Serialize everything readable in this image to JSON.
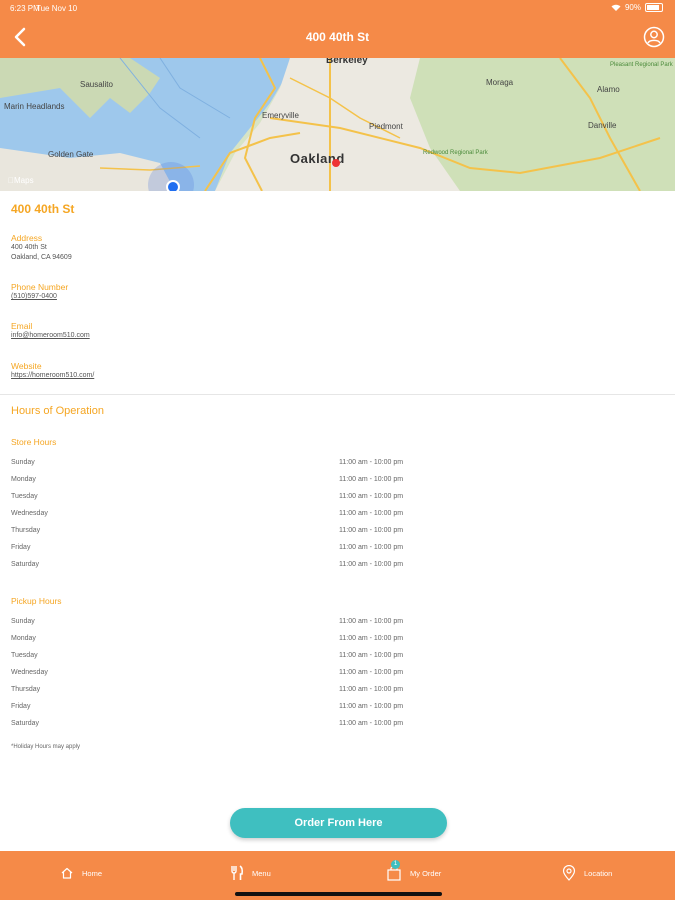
{
  "status_bar": {
    "time": "6:23 PM",
    "date": "Tue Nov 10",
    "battery": "90%"
  },
  "header": {
    "title": "400 40th St"
  },
  "map": {
    "labels": [
      "Berkeley",
      "Oakland",
      "Emeryville",
      "Piedmont",
      "Moraga",
      "Alamo",
      "Danville",
      "Sausalito",
      "Marin Headlands",
      "Golden Gate",
      "Redwood Regional Park",
      "Pleasant Regional Park"
    ],
    "attribution": "Maps"
  },
  "store": {
    "name": "400 40th St",
    "address_label": "Address",
    "address_line1": "400 40th St",
    "address_line2": "Oakland, CA 94609",
    "phone_label": "Phone Number",
    "phone": "(510)597-0400",
    "email_label": "Email",
    "email": "info@homeroom510.com",
    "website_label": "Website",
    "website": "https://homeroom510.com/"
  },
  "hours": {
    "title": "Hours of Operation",
    "store_title": "Store Hours",
    "store": [
      {
        "day": "Sunday",
        "hours": "11:00 am - 10:00 pm"
      },
      {
        "day": "Monday",
        "hours": "11:00 am - 10:00 pm"
      },
      {
        "day": "Tuesday",
        "hours": "11:00 am - 10:00 pm"
      },
      {
        "day": "Wednesday",
        "hours": "11:00 am - 10:00 pm"
      },
      {
        "day": "Thursday",
        "hours": "11:00 am - 10:00 pm"
      },
      {
        "day": "Friday",
        "hours": "11:00 am - 10:00 pm"
      },
      {
        "day": "Saturday",
        "hours": "11:00 am - 10:00 pm"
      }
    ],
    "pickup_title": "Pickup Hours",
    "pickup": [
      {
        "day": "Sunday",
        "hours": "11:00 am - 10:00 pm"
      },
      {
        "day": "Monday",
        "hours": "11:00 am - 10:00 pm"
      },
      {
        "day": "Tuesday",
        "hours": "11:00 am - 10:00 pm"
      },
      {
        "day": "Wednesday",
        "hours": "11:00 am - 10:00 pm"
      },
      {
        "day": "Thursday",
        "hours": "11:00 am - 10:00 pm"
      },
      {
        "day": "Friday",
        "hours": "11:00 am - 10:00 pm"
      },
      {
        "day": "Saturday",
        "hours": "11:00 am - 10:00 pm"
      }
    ],
    "note": "*Holiday Hours may apply"
  },
  "order_button": {
    "label": "Order From Here"
  },
  "tabs": [
    {
      "label": "Home",
      "icon": "home-icon"
    },
    {
      "label": "Menu",
      "icon": "menu-icon"
    },
    {
      "label": "My Order",
      "icon": "bag-icon",
      "badge": "1"
    },
    {
      "label": "Location",
      "icon": "location-icon"
    }
  ],
  "colors": {
    "header": "#f58a48",
    "accent": "#f5a623",
    "button": "#3fbfc0"
  }
}
